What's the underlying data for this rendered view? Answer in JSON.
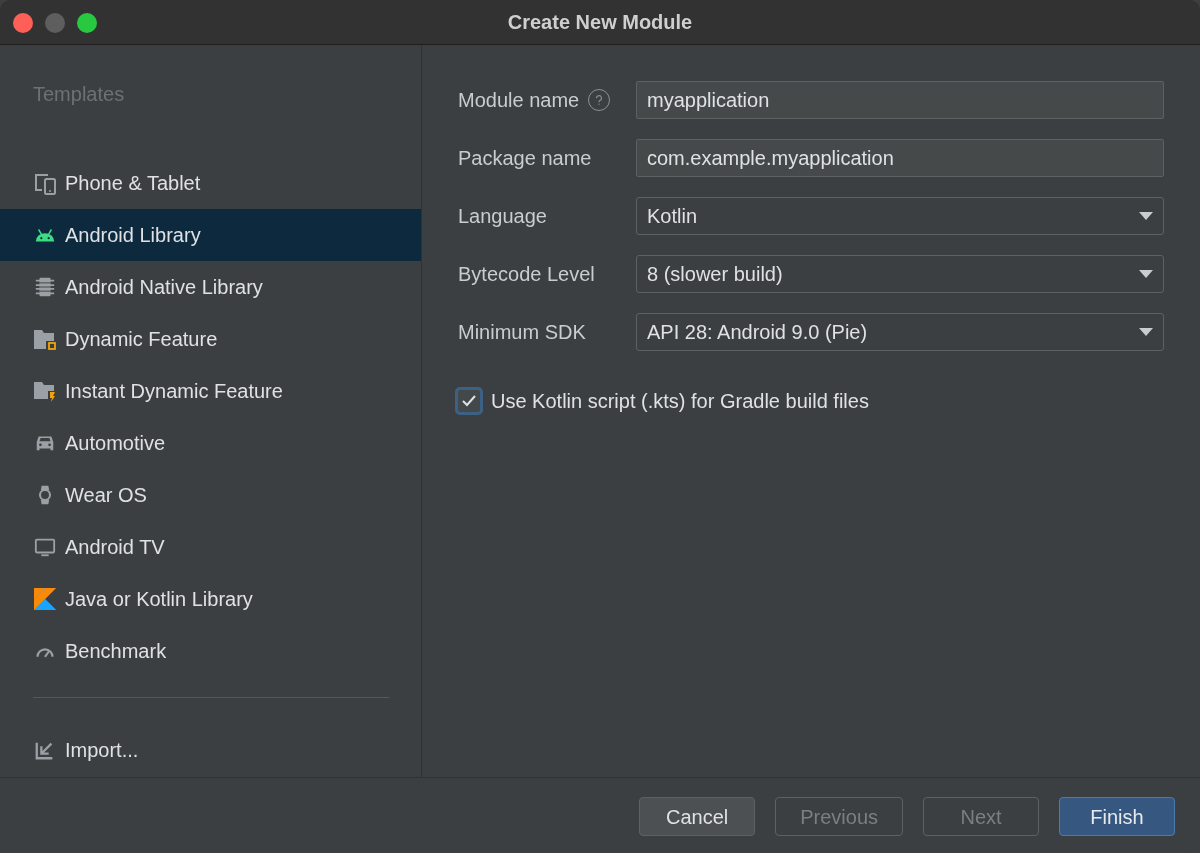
{
  "window": {
    "title": "Create New Module"
  },
  "sidebar": {
    "heading": "Templates",
    "items": [
      {
        "kind": "devices",
        "label": "Phone & Tablet",
        "selected": false
      },
      {
        "kind": "android",
        "label": "Android Library",
        "selected": true
      },
      {
        "kind": "chip",
        "label": "Android Native Library",
        "selected": false
      },
      {
        "kind": "folder-square",
        "label": "Dynamic Feature",
        "selected": false
      },
      {
        "kind": "folder-bolt",
        "label": "Instant Dynamic Feature",
        "selected": false
      },
      {
        "kind": "car",
        "label": "Automotive",
        "selected": false
      },
      {
        "kind": "watch",
        "label": "Wear OS",
        "selected": false
      },
      {
        "kind": "tv",
        "label": "Android TV",
        "selected": false
      },
      {
        "kind": "kotlin",
        "label": "Java or Kotlin Library",
        "selected": false
      },
      {
        "kind": "gauge",
        "label": "Benchmark",
        "selected": false
      }
    ],
    "footer_item": {
      "kind": "import",
      "label": "Import..."
    }
  },
  "form": {
    "fields": [
      {
        "kind": "text",
        "label": "Module name",
        "help": true,
        "value": "myapplication"
      },
      {
        "kind": "text",
        "label": "Package name",
        "help": false,
        "value": "com.example.myapplication"
      },
      {
        "kind": "dropdown",
        "label": "Language",
        "help": false,
        "value": "Kotlin"
      },
      {
        "kind": "dropdown",
        "label": "Bytecode Level",
        "help": false,
        "value": "8 (slower build)"
      },
      {
        "kind": "dropdown",
        "label": "Minimum SDK",
        "help": false,
        "value": "API 28: Android 9.0 (Pie)"
      }
    ],
    "checkbox": {
      "label": "Use Kotlin script (.kts) for Gradle build files",
      "checked": true
    }
  },
  "buttons": [
    {
      "label": "Cancel",
      "disabled": false,
      "default": false
    },
    {
      "label": "Previous",
      "disabled": true,
      "default": false
    },
    {
      "label": "Next",
      "disabled": true,
      "default": false
    },
    {
      "label": "Finish",
      "disabled": false,
      "default": true
    }
  ]
}
